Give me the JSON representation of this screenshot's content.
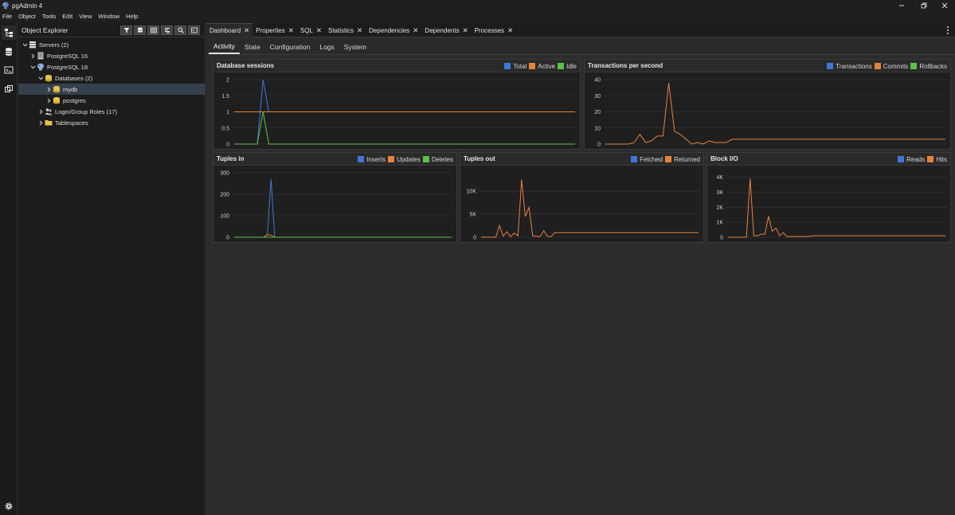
{
  "window": {
    "title": "pgAdmin 4"
  },
  "menu": [
    "File",
    "Object",
    "Tools",
    "Edit",
    "View",
    "Window",
    "Help"
  ],
  "explorer": {
    "title": "Object Explorer",
    "tree": [
      {
        "label": "Servers (2)"
      },
      {
        "label": "PostgreSQL 16"
      },
      {
        "label": "PostgreSQL 18"
      },
      {
        "label": "Databases (2)"
      },
      {
        "label": "mydb"
      },
      {
        "label": "postgres"
      },
      {
        "label": "Login/Group Roles (17)"
      },
      {
        "label": "Tablespaces"
      }
    ]
  },
  "tabs": [
    {
      "label": "Dashboard"
    },
    {
      "label": "Properties"
    },
    {
      "label": "SQL"
    },
    {
      "label": "Statistics"
    },
    {
      "label": "Dependencies"
    },
    {
      "label": "Dependents"
    },
    {
      "label": "Processes"
    }
  ],
  "subtabs": [
    {
      "label": "Activity"
    },
    {
      "label": "State"
    },
    {
      "label": "Configuration"
    },
    {
      "label": "Logs"
    },
    {
      "label": "System"
    }
  ],
  "colors": {
    "blue": "#3f77d8",
    "orange": "#e6833a",
    "green": "#5cc04a"
  },
  "chart_data": [
    {
      "type": "line",
      "title": "Database sessions",
      "legend_placement": "top-right",
      "yticks": [
        "0",
        "0.5",
        "1",
        "1.5",
        "2"
      ],
      "ylim": [
        0,
        2
      ],
      "series": [
        {
          "name": "Total",
          "color": "#3f77d8",
          "values": [
            0,
            0,
            0,
            0,
            0,
            2,
            1,
            1,
            1,
            1,
            1,
            1,
            1,
            1,
            1,
            1,
            1,
            1,
            1,
            1,
            1,
            1,
            1,
            1,
            1,
            1,
            1,
            1,
            1,
            1,
            1,
            1,
            1,
            1,
            1,
            1,
            1,
            1,
            1,
            1,
            1,
            1,
            1,
            1,
            1,
            1,
            1,
            1,
            1,
            1,
            1,
            1,
            1,
            1,
            1,
            1,
            1,
            1,
            1,
            1
          ]
        },
        {
          "name": "Active",
          "color": "#e6833a",
          "values": [
            1,
            1,
            1,
            1,
            1,
            1,
            1,
            1,
            1,
            1,
            1,
            1,
            1,
            1,
            1,
            1,
            1,
            1,
            1,
            1,
            1,
            1,
            1,
            1,
            1,
            1,
            1,
            1,
            1,
            1,
            1,
            1,
            1,
            1,
            1,
            1,
            1,
            1,
            1,
            1,
            1,
            1,
            1,
            1,
            1,
            1,
            1,
            1,
            1,
            1,
            1,
            1,
            1,
            1,
            1,
            1,
            1,
            1,
            1,
            1
          ]
        },
        {
          "name": "Idle",
          "color": "#5cc04a",
          "values": [
            0,
            0,
            0,
            0,
            0,
            1,
            0,
            0,
            0,
            0,
            0,
            0,
            0,
            0,
            0,
            0,
            0,
            0,
            0,
            0,
            0,
            0,
            0,
            0,
            0,
            0,
            0,
            0,
            0,
            0,
            0,
            0,
            0,
            0,
            0,
            0,
            0,
            0,
            0,
            0,
            0,
            0,
            0,
            0,
            0,
            0,
            0,
            0,
            0,
            0,
            0,
            0,
            0,
            0,
            0,
            0,
            0,
            0,
            0,
            0
          ]
        }
      ]
    },
    {
      "type": "line",
      "title": "Transactions per second",
      "legend_placement": "top-right",
      "yticks": [
        "0",
        "10",
        "20",
        "30",
        "40"
      ],
      "ylim": [
        0,
        40
      ],
      "series": [
        {
          "name": "Transactions",
          "color": "#3f77d8",
          "values": []
        },
        {
          "name": "Commits",
          "color": "#e6833a",
          "values": [
            0,
            0,
            0,
            0,
            0,
            1,
            6,
            1,
            2,
            5,
            5,
            38,
            8,
            6,
            3,
            0,
            1,
            0,
            2,
            1,
            1,
            1,
            3,
            3,
            3,
            3,
            3,
            3,
            3,
            3,
            3,
            3,
            3,
            3,
            3,
            3,
            3,
            3,
            3,
            3,
            3,
            3,
            3,
            3,
            3,
            3,
            3,
            3,
            3,
            3,
            3,
            3,
            3,
            3,
            3,
            3,
            3,
            3,
            3,
            3
          ]
        },
        {
          "name": "Rollbacks",
          "color": "#5cc04a",
          "values": []
        }
      ]
    },
    {
      "type": "line",
      "title": "Tuples in",
      "legend_placement": "top-right",
      "yticks": [
        "0",
        "100",
        "200",
        "300"
      ],
      "ylim": [
        0,
        300
      ],
      "series": [
        {
          "name": "Inserts",
          "color": "#3f77d8",
          "values": [
            0,
            0,
            0,
            0,
            0,
            0,
            0,
            0,
            0,
            10,
            270,
            0,
            0,
            0,
            0,
            0,
            0,
            0,
            0,
            0,
            0,
            0,
            0,
            0,
            0,
            0,
            0,
            0,
            0,
            0,
            0,
            0,
            0,
            0,
            0,
            0,
            0,
            0,
            0,
            0,
            0,
            0,
            0,
            0,
            0,
            0,
            0,
            0,
            0,
            0,
            0,
            0,
            0,
            0,
            0,
            0,
            0,
            0,
            0,
            0
          ]
        },
        {
          "name": "Updates",
          "color": "#e6833a",
          "values": [
            0,
            0,
            0,
            0,
            0,
            0,
            0,
            0,
            0,
            12,
            10,
            0,
            0,
            0,
            0,
            0,
            0,
            0,
            0,
            0,
            0,
            0,
            0,
            0,
            0,
            0,
            0,
            0,
            0,
            0,
            0,
            0,
            0,
            0,
            0,
            0,
            0,
            0,
            0,
            0,
            0,
            0,
            0,
            0,
            0,
            0,
            0,
            0,
            0,
            0,
            0,
            0,
            0,
            0,
            0,
            0,
            0,
            0,
            0,
            0
          ]
        },
        {
          "name": "Deletes",
          "color": "#5cc04a",
          "values": [
            0,
            0,
            0,
            0,
            0,
            0,
            0,
            0,
            0,
            0,
            0,
            0,
            0,
            0,
            0,
            0,
            0,
            0,
            0,
            0,
            0,
            0,
            0,
            0,
            0,
            0,
            0,
            0,
            0,
            0,
            0,
            0,
            0,
            0,
            0,
            0,
            0,
            0,
            0,
            0,
            0,
            0,
            0,
            0,
            0,
            0,
            0,
            0,
            0,
            0,
            0,
            0,
            0,
            0,
            0,
            0,
            0,
            0,
            0,
            0
          ]
        }
      ]
    },
    {
      "type": "line",
      "title": "Tuples out",
      "legend_placement": "top-right",
      "yticks": [
        "0",
        "5K",
        "10K"
      ],
      "ylim": [
        0,
        14000
      ],
      "series": [
        {
          "name": "Fetched",
          "color": "#3f77d8",
          "values": []
        },
        {
          "name": "Returned",
          "color": "#e6833a",
          "values": [
            0,
            0,
            0,
            0,
            0,
            2500,
            200,
            1200,
            100,
            900,
            300,
            12500,
            4500,
            6500,
            300,
            200,
            100,
            1400,
            200,
            100,
            1000,
            1000,
            1000,
            1000,
            1000,
            1000,
            1000,
            1000,
            1000,
            1000,
            1000,
            1000,
            1000,
            1000,
            1000,
            1000,
            1000,
            1000,
            1000,
            1000,
            1000,
            1000,
            1000,
            1000,
            1000,
            1000,
            1000,
            1000,
            1000,
            1000,
            1000,
            1000,
            1000,
            1000,
            1000,
            1000,
            1000,
            1000,
            1000,
            1000
          ]
        }
      ]
    },
    {
      "type": "line",
      "title": "Block I/O",
      "legend_placement": "top-right",
      "yticks": [
        "0",
        "1K",
        "2K",
        "3K",
        "4K"
      ],
      "ylim": [
        0,
        4300
      ],
      "series": [
        {
          "name": "Reads",
          "color": "#3f77d8",
          "values": []
        },
        {
          "name": "Hits",
          "color": "#e6833a",
          "values": [
            0,
            0,
            0,
            0,
            0,
            0,
            3900,
            100,
            100,
            200,
            200,
            1400,
            400,
            600,
            100,
            300,
            50,
            50,
            50,
            50,
            50,
            50,
            50,
            100,
            100,
            100,
            100,
            100,
            100,
            100,
            100,
            100,
            100,
            100,
            100,
            100,
            100,
            100,
            100,
            100,
            100,
            100,
            100,
            100,
            100,
            100,
            100,
            100,
            100,
            100,
            100,
            100,
            100,
            100,
            100,
            100,
            100,
            100,
            100,
            100
          ]
        }
      ]
    }
  ]
}
